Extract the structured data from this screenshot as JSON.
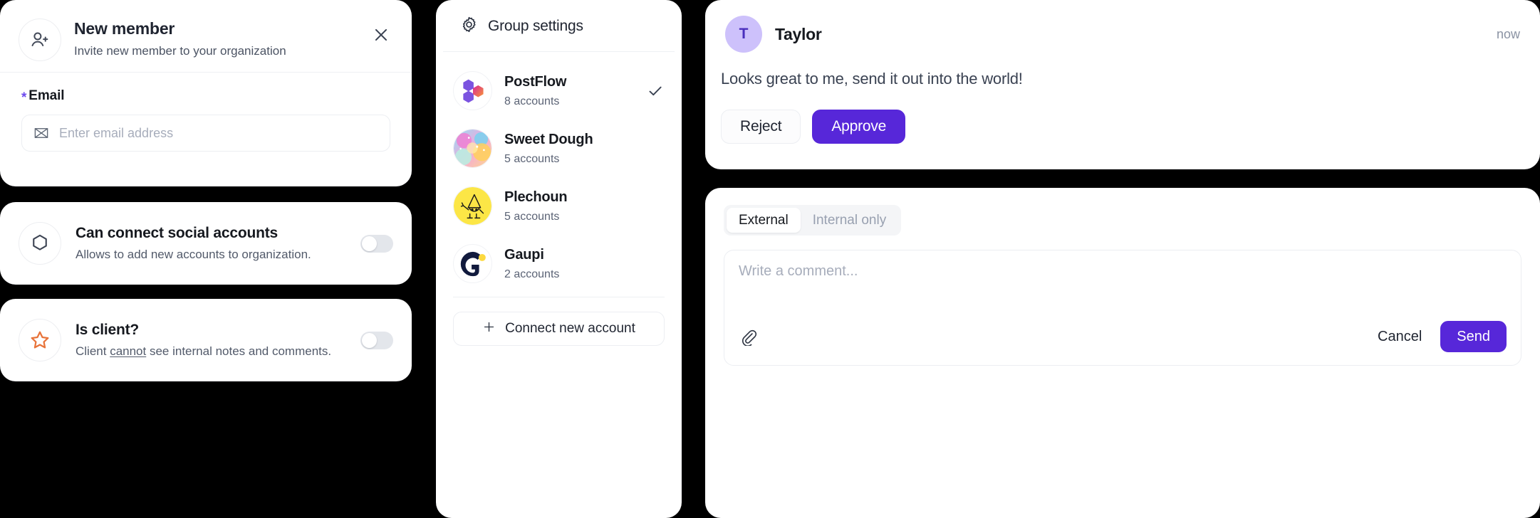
{
  "new_member": {
    "icon": "user-plus-icon",
    "title": "New member",
    "subtitle": "Invite new member to your organization",
    "close_icon": "close-icon",
    "email_label": "Email",
    "required_mark": "*",
    "email_icon": "envelope-icon",
    "email_value": "",
    "email_placeholder": "Enter email address"
  },
  "social_toggle": {
    "icon": "hexagon-icon",
    "title": "Can connect social accounts",
    "subtitle": "Allows to add new accounts to organization.",
    "state": "off"
  },
  "client_toggle": {
    "icon": "star-icon",
    "title": "Is client?",
    "subtitle_before": "Client ",
    "subtitle_emphasis": "cannot",
    "subtitle_after": " see internal notes and comments.",
    "state": "off"
  },
  "group_settings": {
    "icon": "gear-icon",
    "title": "Group settings",
    "items": [
      {
        "name": "PostFlow",
        "count": "8 accounts",
        "avatar": "postflow-logo",
        "selected": true
      },
      {
        "name": "Sweet Dough",
        "count": "5 accounts",
        "avatar": "sweetdough-photo",
        "selected": false
      },
      {
        "name": "Plechoun",
        "count": "5 accounts",
        "avatar": "plechoun-mascot",
        "selected": false
      },
      {
        "name": "Gaupi",
        "count": "2 accounts",
        "avatar": "gaupi-logo",
        "selected": false
      }
    ],
    "connect_label": "Connect new account",
    "connect_icon": "plus-icon"
  },
  "approval": {
    "avatar_initial": "T",
    "author": "Taylor",
    "time": "now",
    "message": "Looks great to me, send it out into the world!",
    "reject_label": "Reject",
    "approve_label": "Approve"
  },
  "comment": {
    "tabs": [
      {
        "label": "External",
        "active": true
      },
      {
        "label": "Internal only",
        "active": false
      }
    ],
    "value": "",
    "placeholder": "Write a comment...",
    "attach_icon": "paperclip-icon",
    "cancel_label": "Cancel",
    "send_label": "Send"
  },
  "colors": {
    "accent": "#5727d9",
    "accent_soft": "#cdc1fb",
    "star": "#e8743b",
    "background": "#000000",
    "card": "#ffffff",
    "muted_text": "#8a92a3"
  }
}
